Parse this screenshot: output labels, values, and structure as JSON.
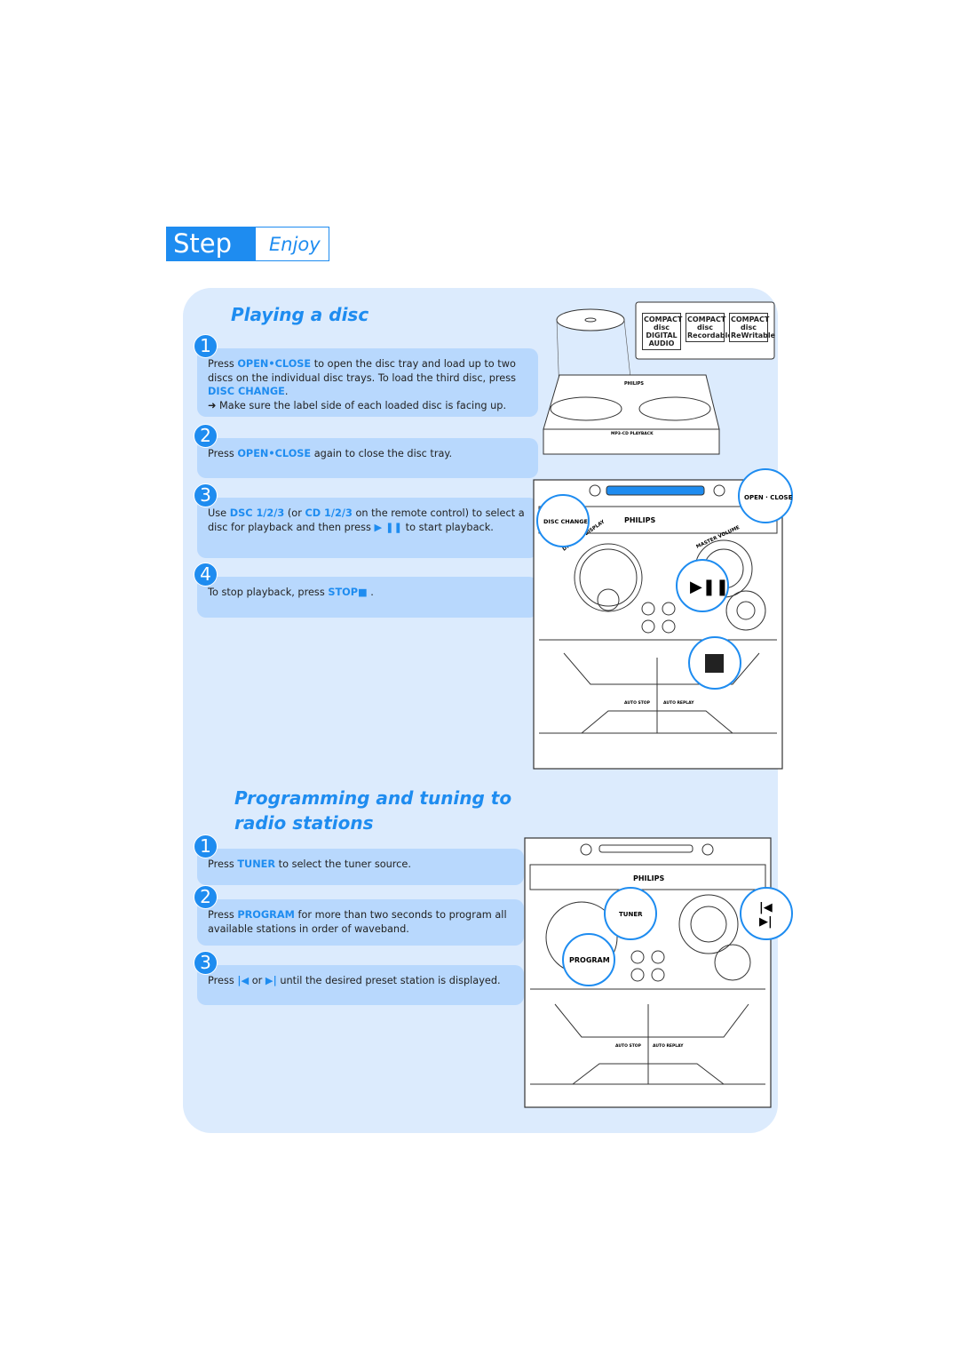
{
  "header": {
    "step": "Step C",
    "subtitle": "Enjoy"
  },
  "section1": {
    "title": "Playing a disc",
    "steps": [
      {
        "num": "1",
        "lines": [
          [
            {
              "t": "Press "
            },
            {
              "t": "OPEN•CLOSE",
              "hl": true
            },
            {
              "t": " to open the disc tray and load up to two discs on the individual disc trays. To load the third disc, press "
            },
            {
              "t": "DISC CHANGE",
              "hl": true
            },
            {
              "t": "."
            }
          ],
          [
            {
              "t": "➜ Make sure the label side of each loaded disc is facing up."
            }
          ]
        ]
      },
      {
        "num": "2",
        "lines": [
          [
            {
              "t": "Press "
            },
            {
              "t": "OPEN•CLOSE",
              "hl": true
            },
            {
              "t": " again to close the disc tray."
            }
          ]
        ]
      },
      {
        "num": "3",
        "lines": [
          [
            {
              "t": "Use "
            },
            {
              "t": "DSC 1/2/3",
              "hl": true
            },
            {
              "t": " (or "
            },
            {
              "t": "CD 1/2/3",
              "hl": true
            },
            {
              "t": " on the remote control) to select a disc for playback and then press  "
            },
            {
              "t": "▶ ❚❚",
              "hl": true
            },
            {
              "t": "  to start playback."
            }
          ]
        ]
      },
      {
        "num": "4",
        "lines": [
          [
            {
              "t": "To stop playback, press "
            },
            {
              "t": "STOP■",
              "hl": true
            },
            {
              "t": " ."
            }
          ]
        ]
      }
    ]
  },
  "section2": {
    "title_line1": "Programming and tuning to",
    "title_line2": "radio stations",
    "steps": [
      {
        "num": "1",
        "lines": [
          [
            {
              "t": "Press "
            },
            {
              "t": "TUNER",
              "hl": true
            },
            {
              "t": " to select the tuner source."
            }
          ]
        ]
      },
      {
        "num": "2",
        "lines": [
          [
            {
              "t": "Press "
            },
            {
              "t": "PROGRAM",
              "hl": true
            },
            {
              "t": " for more than two seconds to program all available stations in order of waveband."
            }
          ]
        ]
      },
      {
        "num": "3",
        "lines": [
          [
            {
              "t": "Press  "
            },
            {
              "t": "|◀",
              "hl": true
            },
            {
              "t": "  or  "
            },
            {
              "t": "▶|",
              "hl": true
            },
            {
              "t": "   until the desired preset station is displayed."
            }
          ]
        ]
      }
    ]
  },
  "illustrations": {
    "brand": "PHILIPS",
    "mp3": "MP3-CD PLAYBACK",
    "open_close": "OPEN · CLOSE",
    "disc_change": "DISC CHANGE",
    "tuner": "TUNER",
    "program": "PROGRAM",
    "auto_stop": "AUTO STOP",
    "auto_replay": "AUTO REPLAY",
    "disc_logos": [
      "COMPACT disc DIGITAL AUDIO",
      "COMPACT disc Recordable",
      "COMPACT disc ReWritable"
    ],
    "dynamic_display": "DYNAMIC DISPLAY",
    "master_volume": "MASTER VOLUME"
  },
  "colors": {
    "accent": "#1e8cf0",
    "panel": "#dcebfd",
    "step_box": "#b8d8fd"
  }
}
